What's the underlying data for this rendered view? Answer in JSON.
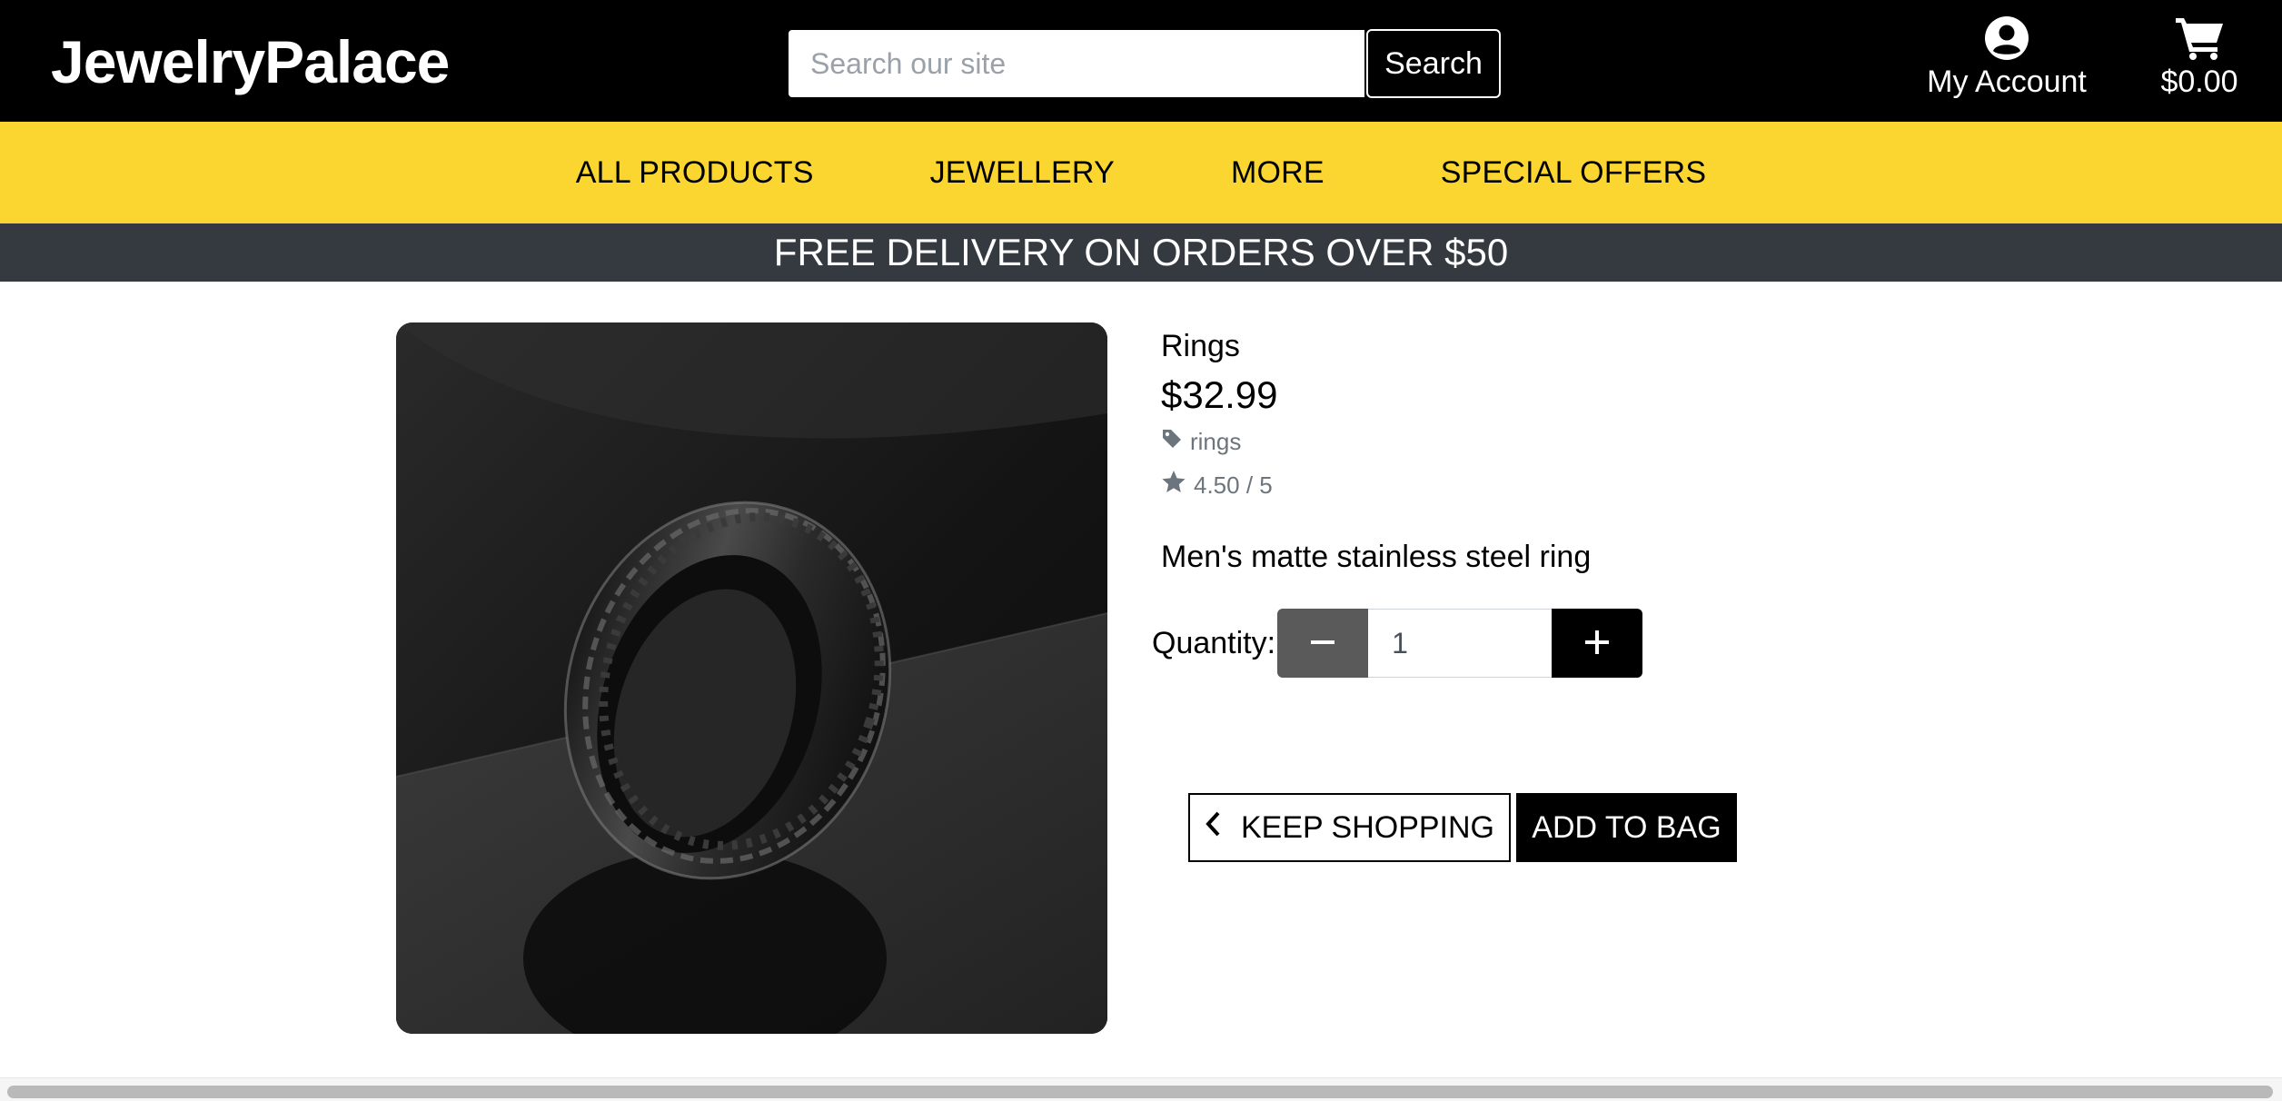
{
  "header": {
    "logo": "JewelryPalace",
    "search": {
      "placeholder": "Search our site",
      "value": "",
      "button_label": "Search"
    },
    "account_label": "My Account",
    "cart_total": "$0.00"
  },
  "nav": {
    "items": [
      {
        "label": "ALL PRODUCTS"
      },
      {
        "label": "JEWELLERY"
      },
      {
        "label": "MORE"
      },
      {
        "label": "SPECIAL OFFERS"
      }
    ]
  },
  "banner": {
    "text": "FREE DELIVERY ON ORDERS OVER $50"
  },
  "product": {
    "name": "Rings",
    "price": "$32.99",
    "category": "rings",
    "rating": "4.50 / 5",
    "description": "Men's matte stainless steel ring",
    "image_icon": "ring-photo"
  },
  "quantity": {
    "label": "Quantity:",
    "value": "1"
  },
  "actions": {
    "keep_shopping": "KEEP SHOPPING",
    "add_to_bag": "ADD TO BAG"
  },
  "colors": {
    "header_bg": "#000000",
    "nav_bg": "#fcd630",
    "banner_bg": "#343a40",
    "muted_text": "#6c757d",
    "qty_minus_bg": "#5a5a5a"
  }
}
